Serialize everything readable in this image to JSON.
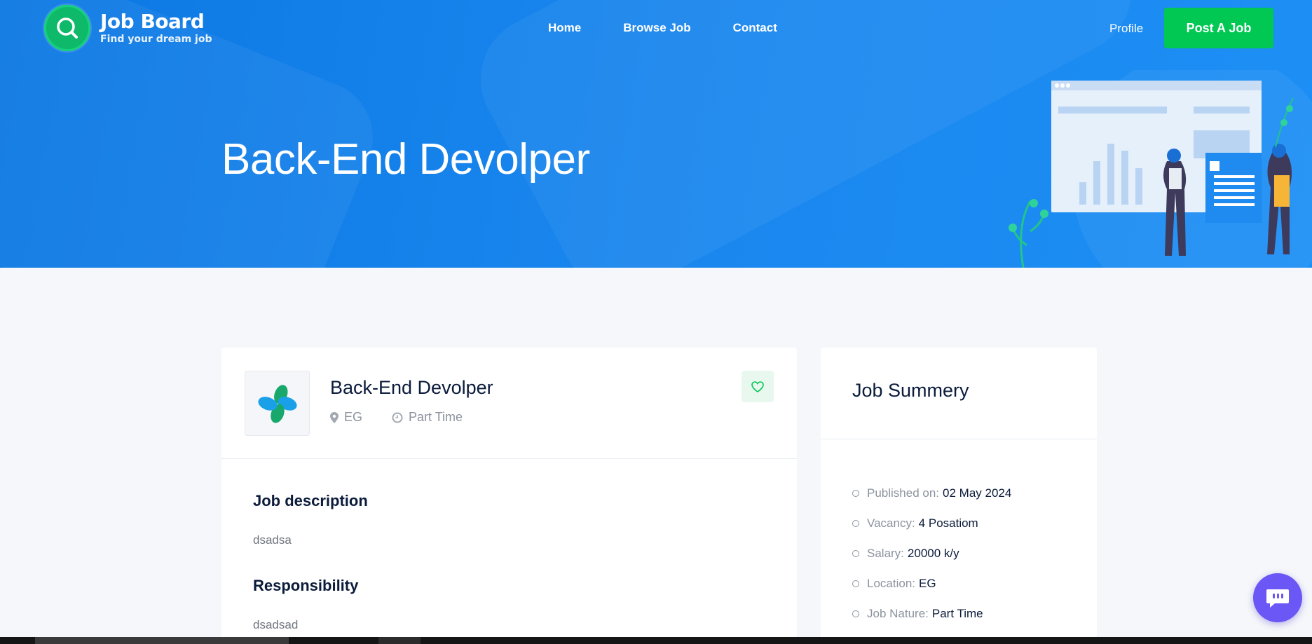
{
  "header": {
    "logo_title": "Job Board",
    "logo_subtitle": "Find your dream job",
    "nav": [
      {
        "label": "Home"
      },
      {
        "label": "Browse Job"
      },
      {
        "label": "Contact"
      }
    ],
    "profile_label": "Profile",
    "post_job_label": "Post A Job"
  },
  "hero": {
    "title": "Back-End Devolper"
  },
  "job": {
    "title": "Back-End Devolper",
    "location": "EG",
    "type": "Part Time",
    "sections": [
      {
        "title": "Job description",
        "text": "dsadsa"
      },
      {
        "title": "Responsibility",
        "text": "dsadsad"
      }
    ]
  },
  "summary": {
    "title": "Job Summery",
    "items": [
      {
        "label": "Published on:",
        "value": "02 May 2024"
      },
      {
        "label": "Vacancy:",
        "value": "4 Posatiom"
      },
      {
        "label": "Salary:",
        "value": "20000 k/y"
      },
      {
        "label": "Location:",
        "value": "EG"
      },
      {
        "label": "Job Nature:",
        "value": "Part Time"
      }
    ]
  },
  "colors": {
    "hero": "#0b78e3",
    "accent_green": "#00c853",
    "chat": "#6a57f5"
  },
  "icons": [
    "search-icon",
    "map-pin-icon",
    "clock-icon",
    "heart-icon",
    "chat-icon"
  ]
}
